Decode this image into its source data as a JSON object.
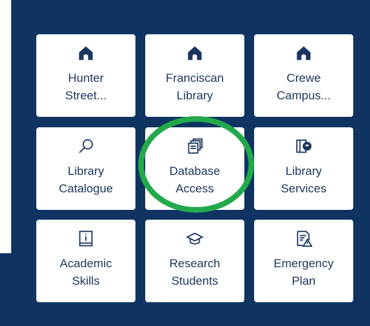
{
  "tiles": [
    {
      "label": "Hunter\nStreet...",
      "icon": "home-icon"
    },
    {
      "label": "Franciscan\nLibrary",
      "icon": "home-icon"
    },
    {
      "label": "Crewe\nCampus...",
      "icon": "home-icon"
    },
    {
      "label": "Library\nCatalogue",
      "icon": "search-icon"
    },
    {
      "label": "Database\nAccess",
      "icon": "stacked-documents-icon"
    },
    {
      "label": "Library\nServices",
      "icon": "book-graduate-icon"
    },
    {
      "label": "Academic\nSkills",
      "icon": "book-info-icon"
    },
    {
      "label": "Research\nStudents",
      "icon": "graduation-cap-icon"
    },
    {
      "label": "Emergency\nPlan",
      "icon": "document-warning-icon"
    }
  ],
  "colors": {
    "panel_background": "#0f3461",
    "tile_background": "#ffffff",
    "tile_text": "#1a355e",
    "highlight_ring": "#22a94b"
  }
}
